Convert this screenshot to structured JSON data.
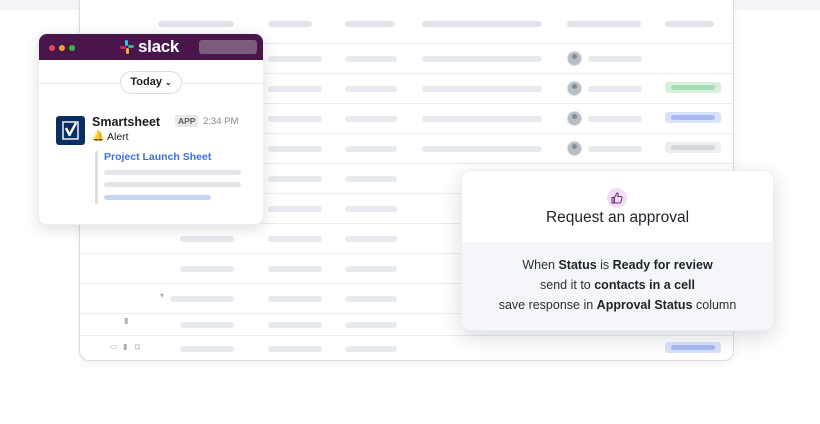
{
  "slack": {
    "brand": "slack",
    "date_pill": "Today",
    "header_color": "#4a154b",
    "window_dots": [
      "#e24b57",
      "#e9a233",
      "#3fb64b"
    ],
    "message": {
      "app_name": "Smartsheet",
      "badge": "APP",
      "time": "2:34 PM",
      "alert_emoji": "🔔",
      "alert_label": "Alert",
      "link_text": "Project Launch Sheet"
    }
  },
  "approval": {
    "title": "Request an approval",
    "line1": {
      "a": "When ",
      "b": "Status",
      "c": " is ",
      "d": "Ready for review"
    },
    "line2": {
      "a": "send it to ",
      "b": "contacts in a cell"
    },
    "line3": {
      "a": "save response in ",
      "b": "Approval Status",
      "c": " column"
    }
  },
  "sheet": {
    "status_colors": {
      "green": "#a8dcb5",
      "blue": "#a8b9f1",
      "gray": "#d2d6dd"
    }
  }
}
